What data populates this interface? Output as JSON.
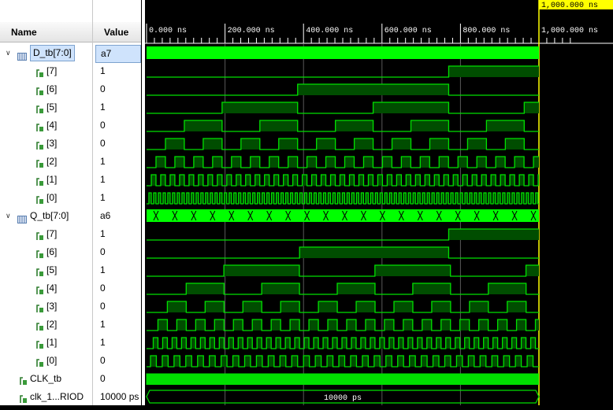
{
  "columns": {
    "name": "Name",
    "value": "Value"
  },
  "timeline": {
    "cursor_label": "1,000.000 ns",
    "ticks": [
      "0.000 ns",
      "200.000 ns",
      "400.000 ns",
      "600.000 ns",
      "800.000 ns",
      "1,000.000 ns"
    ]
  },
  "signals": [
    {
      "name": "D_tb[7:0]",
      "value": "a7",
      "kind": "bus",
      "expanded": true
    },
    {
      "name": "[7]",
      "value": "1",
      "kind": "bit"
    },
    {
      "name": "[6]",
      "value": "0",
      "kind": "bit"
    },
    {
      "name": "[5]",
      "value": "1",
      "kind": "bit"
    },
    {
      "name": "[4]",
      "value": "0",
      "kind": "bit"
    },
    {
      "name": "[3]",
      "value": "0",
      "kind": "bit"
    },
    {
      "name": "[2]",
      "value": "1",
      "kind": "bit"
    },
    {
      "name": "[1]",
      "value": "1",
      "kind": "bit"
    },
    {
      "name": "[0]",
      "value": "1",
      "kind": "bit"
    },
    {
      "name": "Q_tb[7:0]",
      "value": "a6",
      "kind": "bus",
      "expanded": true
    },
    {
      "name": "[7]",
      "value": "1",
      "kind": "bit"
    },
    {
      "name": "[6]",
      "value": "0",
      "kind": "bit"
    },
    {
      "name": "[5]",
      "value": "1",
      "kind": "bit"
    },
    {
      "name": "[4]",
      "value": "0",
      "kind": "bit"
    },
    {
      "name": "[3]",
      "value": "0",
      "kind": "bit"
    },
    {
      "name": "[2]",
      "value": "1",
      "kind": "bit"
    },
    {
      "name": "[1]",
      "value": "1",
      "kind": "bit"
    },
    {
      "name": "[0]",
      "value": "0",
      "kind": "bit"
    },
    {
      "name": "CLK_tb",
      "value": "0",
      "kind": "bit"
    },
    {
      "name": "clk_1...RIOD",
      "value": "10000 ps",
      "kind": "bit"
    }
  ],
  "period_wave_label": "10000 ps",
  "colors": {
    "wave": "#00e000",
    "bus_fill": "#00ff00",
    "high_fill": "#004d00",
    "cursor": "#ffff00",
    "grid": "#7f7f7f"
  }
}
